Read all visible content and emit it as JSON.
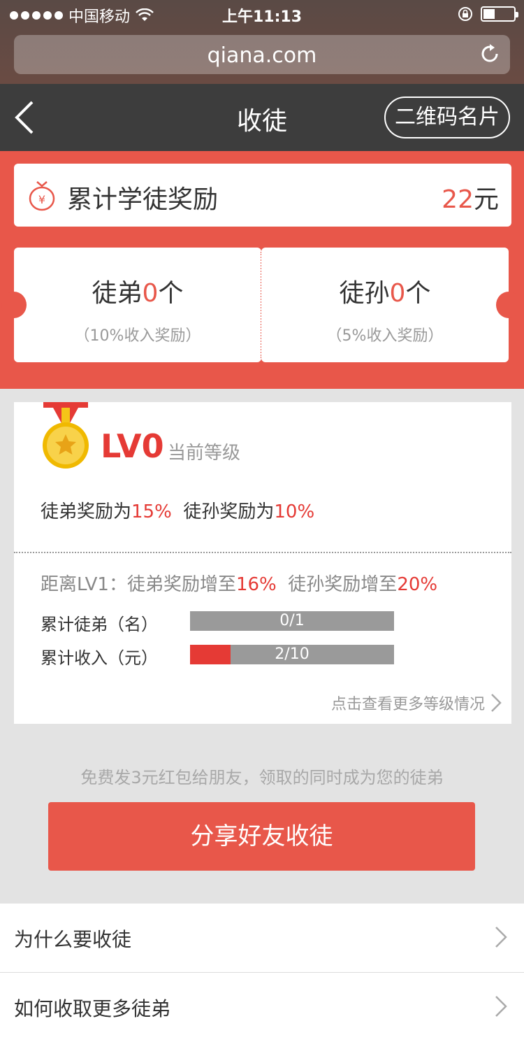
{
  "status_bar": {
    "carrier": "中国移动",
    "time": "上午11:13"
  },
  "browser": {
    "url": "qiana.com"
  },
  "nav": {
    "title": "收徒",
    "qr_button": "二维码名片"
  },
  "total_reward": {
    "label": "累计学徒奖励",
    "amount": "22",
    "unit": "元"
  },
  "apprentices": {
    "disciple_prefix": "徒弟",
    "disciple_count": "0",
    "disciple_suffix": "个",
    "disciple_note": "（10%收入奖励）",
    "grand_prefix": "徒孙",
    "grand_count": "0",
    "grand_suffix": "个",
    "grand_note": "（5%收入奖励）"
  },
  "level": {
    "name": "LV0",
    "label": "当前等级",
    "disciple_text": "徒弟奖励为",
    "disciple_pct": "15%",
    "grand_text": "徒孙奖励为",
    "grand_pct": "10%",
    "next_prefix": "距离LV1：徒弟奖励增至",
    "next_disciple_pct": "16%",
    "next_mid": "徒孙奖励增至",
    "next_grand_pct": "20%",
    "progress": [
      {
        "label": "累计徒弟（名）",
        "text": "0/1",
        "value": 0,
        "max": 1
      },
      {
        "label": "累计收入（元）",
        "text": "2/10",
        "value": 2,
        "max": 10
      }
    ],
    "more_link": "点击查看更多等级情况"
  },
  "share": {
    "hint": "免费发3元红包给朋友，领取的同时成为您的徒弟",
    "button": "分享好友收徒"
  },
  "faq": {
    "items": [
      {
        "label": "为什么要收徒"
      },
      {
        "label": "如何收取更多徒弟"
      }
    ]
  },
  "colors": {
    "accent": "#e8574a",
    "level_red": "#e53a35",
    "navbar": "#3d3d3d"
  }
}
